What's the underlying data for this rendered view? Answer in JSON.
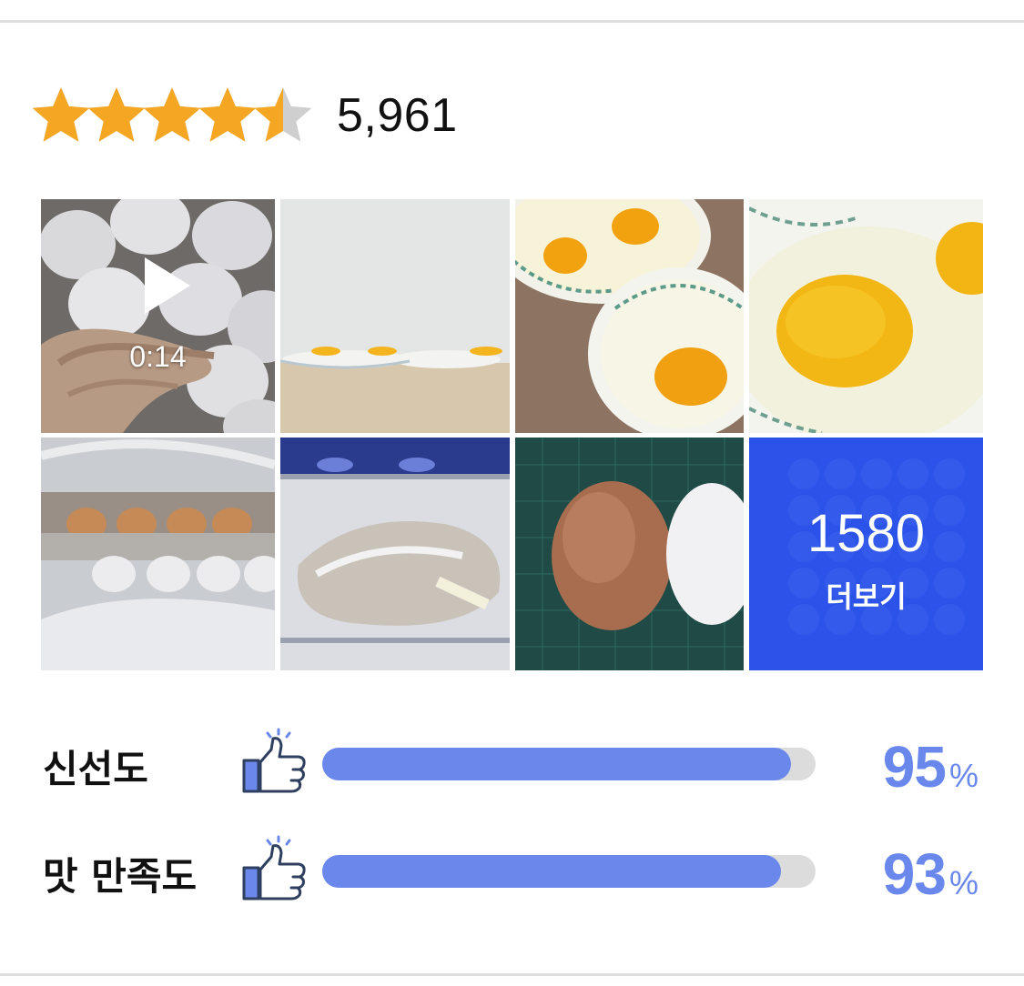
{
  "rating": {
    "stars_value": 4.5,
    "stars_max": 5,
    "star_color": "#f5a623",
    "count": "5,961"
  },
  "gallery": {
    "video": {
      "duration": "0:14",
      "icon": "play-icon"
    },
    "photos": [
      "eggs-in-hand-video",
      "egg-plates-on-table",
      "cracked-eggs-on-plates",
      "egg-yolk-closeup",
      "egg-trays-in-bag",
      "eggs-in-fridge-bag",
      "brown-and-white-egg",
      "egg-tray-more"
    ],
    "more": {
      "count": "1580",
      "label": "더보기",
      "overlay_color": "#2850eb"
    }
  },
  "metrics": [
    {
      "label": "신선도",
      "value": 95,
      "number": "95",
      "unit": "%",
      "icon": "thumbs-up-icon"
    },
    {
      "label": "맛 만족도",
      "value": 93,
      "number": "93",
      "unit": "%",
      "icon": "thumbs-up-icon"
    }
  ],
  "colors": {
    "accent": "#6a88ec",
    "bar_track": "#dcdcdc",
    "star": "#f5a623",
    "star_empty": "#cfcfcf"
  }
}
